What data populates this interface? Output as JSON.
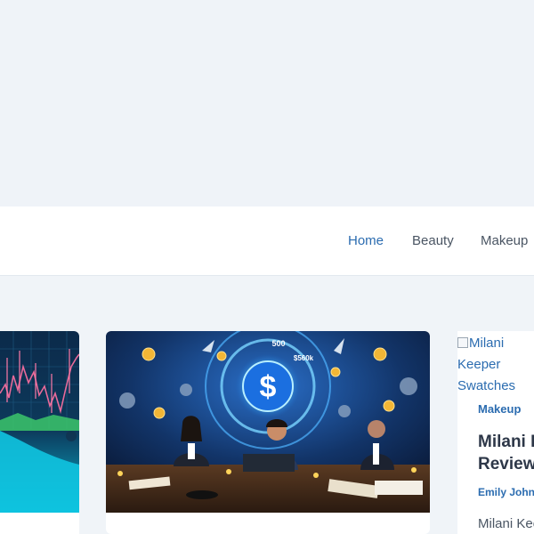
{
  "nav": {
    "items": [
      {
        "label": "Home",
        "active": true
      },
      {
        "label": "Beauty",
        "active": false
      },
      {
        "label": "Makeup",
        "active": false
      }
    ]
  },
  "cards": {
    "left": {
      "image": "trading-chart-illustration"
    },
    "middle": {
      "image": "business-meeting-dollar-illustration",
      "image_text": [
        "500",
        "$560k"
      ]
    },
    "right": {
      "image_alt": "Milani Keeper Swatches",
      "category": "Makeup",
      "title": "Milani Keeper Balm Review",
      "author": "Emily Johnson",
      "excerpt": "Milani Keeper"
    }
  },
  "colors": {
    "accent": "#2b6cb0",
    "background": "#f0f4f8",
    "text": "#2d3748"
  }
}
